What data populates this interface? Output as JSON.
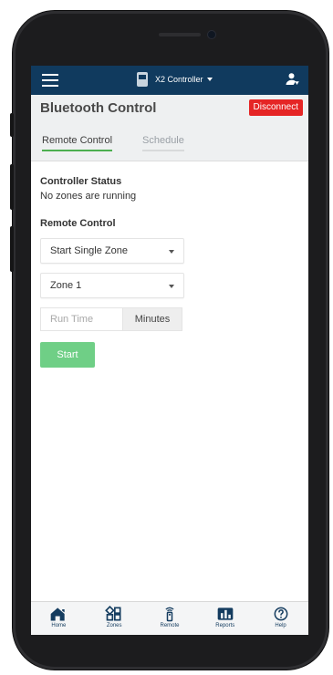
{
  "topbar": {
    "controller_name": "X2 Controller"
  },
  "header": {
    "title": "Bluetooth Control",
    "disconnect_label": "Disconnect"
  },
  "tabs": [
    {
      "label": "Remote Control",
      "active": true
    },
    {
      "label": "Schedule",
      "active": false
    }
  ],
  "status": {
    "heading": "Controller Status",
    "text": "No zones are running"
  },
  "remote": {
    "heading": "Remote Control",
    "mode_value": "Start Single Zone",
    "zone_value": "Zone 1",
    "runtime_placeholder": "Run Time",
    "runtime_suffix": "Minutes",
    "start_label": "Start"
  },
  "nav": [
    {
      "label": "Home",
      "icon": "home-icon"
    },
    {
      "label": "Zones",
      "icon": "zones-icon"
    },
    {
      "label": "Remote",
      "icon": "remote-icon"
    },
    {
      "label": "Reports",
      "icon": "reports-icon"
    },
    {
      "label": "Help",
      "icon": "help-icon"
    }
  ],
  "colors": {
    "topbar": "#103a5e",
    "disconnect": "#e52525",
    "accent_green": "#4caf50",
    "start_button": "#6fcf86"
  }
}
